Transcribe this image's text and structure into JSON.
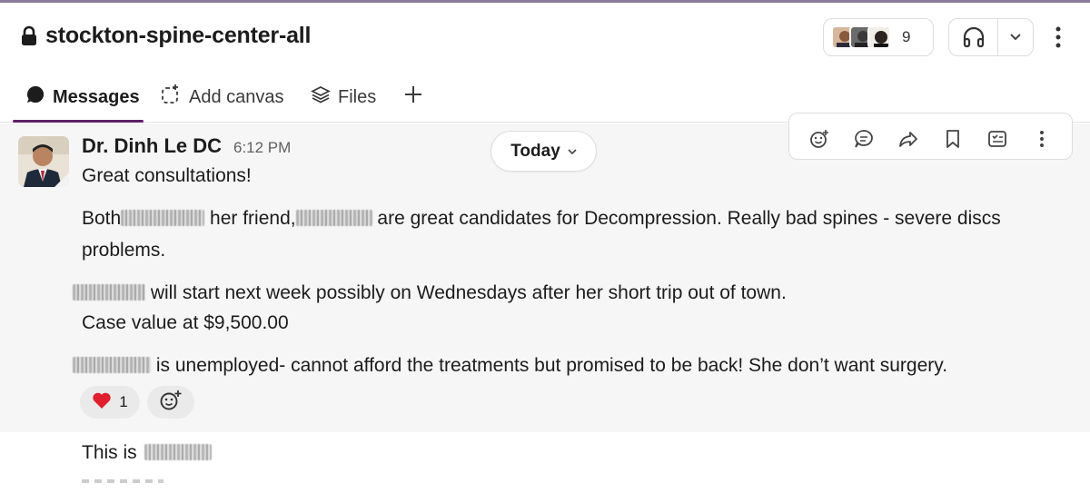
{
  "header": {
    "channel_name": "stockton-spine-center-all",
    "member_count": "9"
  },
  "tabs": [
    {
      "label": "Messages",
      "icon": "message-bubble-icon",
      "active": true
    },
    {
      "label": "Add canvas",
      "icon": "canvas-icon",
      "active": false
    },
    {
      "label": "Files",
      "icon": "files-stack-icon",
      "active": false
    }
  ],
  "message": {
    "sender": "Dr. Dinh Le DC",
    "time": "6:12 PM",
    "line1": "Great consultations!",
    "line2a_prefix": "Both",
    "line2a_mid": " her friend,",
    "line2a_suffix": " are great candidates for Decompression. Really bad spines - severe discs",
    "line2b": "problems.",
    "line3": " will start next week possibly on Wednesdays after her short trip out of town.",
    "line4": "Case value at $9,500.00",
    "line5": " is unemployed- cannot afford the treatments but promised to be back! She don’t want surgery.",
    "reaction_emoji": "❤️",
    "reaction_count": "1"
  },
  "date_divider": {
    "label": "Today"
  },
  "next_message": {
    "prefix": "This is"
  },
  "colors": {
    "accent": "#611f69",
    "message_bg": "#f6f6f6",
    "heart": "#e01e2e"
  }
}
